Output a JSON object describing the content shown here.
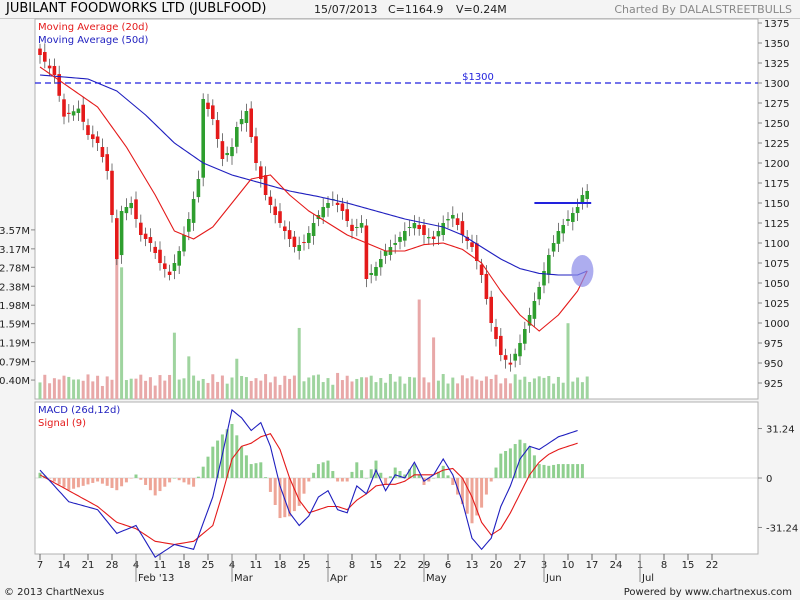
{
  "header": {
    "title": "JUBILANT FOODWORKS LTD (JUBLFOOD)",
    "date": "15/07/2013",
    "close": "C=1164.9",
    "volume": "V=0.24M",
    "credit": "Charted By DALALSTREETBULLS"
  },
  "footer": {
    "copyright": "© 2013 ChartNexus",
    "powered": "Powered by www.chartnexus.com"
  },
  "colors": {
    "up": "#2e9e2e",
    "down": "#e41a1a",
    "ma20": "#e41a1a",
    "ma50": "#1f1fbf",
    "vol_up": "#9fd49f",
    "vol_down": "#e8a8a8",
    "macd": "#1f1fbf",
    "signal": "#e41a1a",
    "hist_up": "#8fcf8f",
    "hist_down": "#eea597",
    "resistance": "#2222dd",
    "highlight": "#8a8ae8"
  },
  "chart_data": [
    {
      "type": "candlestick",
      "title": "",
      "legend": [
        "Moving Average (20d)",
        "Moving Average (50d)"
      ],
      "legend_placement": "top-left",
      "price_ticks": [
        925,
        950,
        975,
        1000,
        1025,
        1050,
        1075,
        1100,
        1125,
        1150,
        1175,
        1200,
        1225,
        1250,
        1275,
        1300,
        1325,
        1350,
        1375
      ],
      "ylim": [
        905,
        1380
      ],
      "volume_ticks": [
        "0.40M",
        "0.79M",
        "1.19M",
        "1.59M",
        "1.98M",
        "2.38M",
        "2.78M",
        "3.17M",
        "3.57M"
      ],
      "volume_tick_values": [
        0.4,
        0.79,
        1.19,
        1.59,
        1.98,
        2.38,
        2.78,
        3.17,
        3.57
      ],
      "volume_max": 3.8,
      "annotation": "$1300",
      "annotation_level": 1300,
      "resistance_level": 1150,
      "x_ticks": [
        "7",
        "14",
        "21",
        "28",
        "4",
        "11",
        "18",
        "25",
        "4",
        "11",
        "18",
        "25",
        "1",
        "8",
        "15",
        "22",
        "29",
        "6",
        "13",
        "20",
        "27",
        "3",
        "10",
        "17",
        "24",
        "1",
        "8",
        "15",
        "22"
      ],
      "x_tick_days": [
        0,
        5,
        10,
        15,
        20,
        25,
        30,
        35,
        40,
        45,
        50,
        55,
        60,
        65,
        70,
        75,
        80,
        85,
        90,
        95,
        100,
        105,
        110,
        115,
        120,
        125,
        130,
        135,
        140
      ],
      "month_labels": [
        {
          "label": "Feb '13",
          "day": 20
        },
        {
          "label": "Mar",
          "day": 40
        },
        {
          "label": "Apr",
          "day": 60
        },
        {
          "label": "May",
          "day": 80
        },
        {
          "label": "Jun",
          "day": 105
        },
        {
          "label": "Jul",
          "day": 125
        }
      ],
      "price_keypoints": [
        [
          0,
          1335
        ],
        [
          3,
          1310
        ],
        [
          5,
          1258
        ],
        [
          8,
          1268
        ],
        [
          10,
          1235
        ],
        [
          12,
          1225
        ],
        [
          14,
          1190
        ],
        [
          16,
          1080
        ],
        [
          17,
          1140
        ],
        [
          19,
          1150
        ],
        [
          21,
          1110
        ],
        [
          23,
          1100
        ],
        [
          25,
          1075
        ],
        [
          27,
          1060
        ],
        [
          29,
          1090
        ],
        [
          31,
          1130
        ],
        [
          33,
          1180
        ],
        [
          34,
          1280
        ],
        [
          36,
          1255
        ],
        [
          37,
          1230
        ],
        [
          38,
          1205
        ],
        [
          40,
          1220
        ],
        [
          41,
          1245
        ],
        [
          43,
          1265
        ],
        [
          45,
          1200
        ],
        [
          47,
          1160
        ],
        [
          49,
          1135
        ],
        [
          51,
          1115
        ],
        [
          53,
          1095
        ],
        [
          55,
          1100
        ],
        [
          57,
          1125
        ],
        [
          59,
          1145
        ],
        [
          61,
          1155
        ],
        [
          63,
          1140
        ],
        [
          65,
          1115
        ],
        [
          67,
          1125
        ],
        [
          68,
          1055
        ],
        [
          70,
          1070
        ],
        [
          72,
          1090
        ],
        [
          74,
          1100
        ],
        [
          76,
          1115
        ],
        [
          78,
          1125
        ],
        [
          80,
          1110
        ],
        [
          82,
          1105
        ],
        [
          84,
          1125
        ],
        [
          86,
          1135
        ],
        [
          88,
          1110
        ],
        [
          90,
          1095
        ],
        [
          92,
          1060
        ],
        [
          94,
          1000
        ],
        [
          96,
          960
        ],
        [
          98,
          948
        ],
        [
          100,
          975
        ],
        [
          102,
          1010
        ],
        [
          104,
          1045
        ],
        [
          106,
          1085
        ],
        [
          108,
          1115
        ],
        [
          110,
          1130
        ],
        [
          112,
          1145
        ],
        [
          113,
          1160
        ],
        [
          114,
          1165
        ]
      ],
      "volume_spikes": [
        [
          16,
          3.57
        ],
        [
          17,
          2.78
        ],
        [
          28,
          1.4
        ],
        [
          31,
          0.9
        ],
        [
          41,
          0.85
        ],
        [
          54,
          1.5
        ],
        [
          57,
          0.5
        ],
        [
          62,
          0.55
        ],
        [
          79,
          2.1
        ],
        [
          82,
          1.3
        ],
        [
          110,
          1.6
        ]
      ],
      "ma20_keypoints": [
        [
          0,
          1320
        ],
        [
          6,
          1295
        ],
        [
          12,
          1270
        ],
        [
          18,
          1220
        ],
        [
          24,
          1160
        ],
        [
          28,
          1115
        ],
        [
          32,
          1105
        ],
        [
          36,
          1120
        ],
        [
          40,
          1150
        ],
        [
          44,
          1180
        ],
        [
          48,
          1185
        ],
        [
          52,
          1160
        ],
        [
          56,
          1140
        ],
        [
          60,
          1125
        ],
        [
          64,
          1110
        ],
        [
          68,
          1100
        ],
        [
          72,
          1090
        ],
        [
          76,
          1090
        ],
        [
          80,
          1098
        ],
        [
          84,
          1100
        ],
        [
          88,
          1092
        ],
        [
          92,
          1075
        ],
        [
          96,
          1040
        ],
        [
          100,
          1010
        ],
        [
          104,
          990
        ],
        [
          108,
          1010
        ],
        [
          112,
          1040
        ],
        [
          114,
          1065
        ]
      ],
      "ma50_keypoints": [
        [
          0,
          1310
        ],
        [
          10,
          1305
        ],
        [
          16,
          1290
        ],
        [
          22,
          1260
        ],
        [
          28,
          1225
        ],
        [
          34,
          1200
        ],
        [
          40,
          1185
        ],
        [
          46,
          1175
        ],
        [
          52,
          1165
        ],
        [
          58,
          1158
        ],
        [
          64,
          1150
        ],
        [
          70,
          1140
        ],
        [
          76,
          1130
        ],
        [
          80,
          1125
        ],
        [
          84,
          1120
        ],
        [
          88,
          1110
        ],
        [
          92,
          1095
        ],
        [
          96,
          1080
        ],
        [
          100,
          1068
        ],
        [
          104,
          1062
        ],
        [
          108,
          1060
        ],
        [
          112,
          1060
        ],
        [
          114,
          1065
        ]
      ]
    },
    {
      "type": "line",
      "title": "",
      "series": [
        {
          "name": "MACD (26d,12d)",
          "keypoints": [
            [
              0,
              5
            ],
            [
              6,
              -15
            ],
            [
              12,
              -20
            ],
            [
              16,
              -35
            ],
            [
              20,
              -30
            ],
            [
              24,
              -50
            ],
            [
              28,
              -42
            ],
            [
              32,
              -45
            ],
            [
              36,
              -12
            ],
            [
              38,
              15
            ],
            [
              40,
              43
            ],
            [
              42,
              38
            ],
            [
              44,
              30
            ],
            [
              46,
              35
            ],
            [
              48,
              20
            ],
            [
              50,
              -5
            ],
            [
              52,
              -22
            ],
            [
              54,
              -30
            ],
            [
              56,
              -24
            ],
            [
              58,
              -12
            ],
            [
              60,
              -8
            ],
            [
              62,
              -20
            ],
            [
              64,
              -22
            ],
            [
              66,
              -5
            ],
            [
              68,
              -10
            ],
            [
              70,
              5
            ],
            [
              72,
              -8
            ],
            [
              74,
              2
            ],
            [
              76,
              0
            ],
            [
              78,
              10
            ],
            [
              80,
              -2
            ],
            [
              82,
              2
            ],
            [
              84,
              12
            ],
            [
              86,
              2
            ],
            [
              88,
              -15
            ],
            [
              90,
              -38
            ],
            [
              92,
              -45
            ],
            [
              94,
              -38
            ],
            [
              96,
              -18
            ],
            [
              98,
              -5
            ],
            [
              100,
              12
            ],
            [
              102,
              20
            ],
            [
              104,
              18
            ],
            [
              106,
              22
            ],
            [
              108,
              26
            ],
            [
              110,
              28
            ],
            [
              112,
              30
            ]
          ]
        },
        {
          "name": "Signal (9)",
          "keypoints": [
            [
              0,
              2
            ],
            [
              6,
              -8
            ],
            [
              12,
              -18
            ],
            [
              16,
              -28
            ],
            [
              20,
              -32
            ],
            [
              24,
              -40
            ],
            [
              28,
              -42
            ],
            [
              32,
              -40
            ],
            [
              36,
              -30
            ],
            [
              38,
              -10
            ],
            [
              40,
              12
            ],
            [
              42,
              20
            ],
            [
              44,
              22
            ],
            [
              46,
              26
            ],
            [
              48,
              28
            ],
            [
              50,
              18
            ],
            [
              52,
              0
            ],
            [
              54,
              -14
            ],
            [
              56,
              -22
            ],
            [
              58,
              -20
            ],
            [
              60,
              -18
            ],
            [
              62,
              -18
            ],
            [
              64,
              -20
            ],
            [
              66,
              -14
            ],
            [
              68,
              -10
            ],
            [
              70,
              -5
            ],
            [
              72,
              -4
            ],
            [
              74,
              -4
            ],
            [
              76,
              -2
            ],
            [
              78,
              2
            ],
            [
              80,
              2
            ],
            [
              82,
              2
            ],
            [
              84,
              5
            ],
            [
              86,
              6
            ],
            [
              88,
              0
            ],
            [
              90,
              -12
            ],
            [
              92,
              -28
            ],
            [
              94,
              -36
            ],
            [
              96,
              -32
            ],
            [
              98,
              -22
            ],
            [
              100,
              -10
            ],
            [
              102,
              2
            ],
            [
              104,
              10
            ],
            [
              106,
              15
            ],
            [
              108,
              18
            ],
            [
              110,
              20
            ],
            [
              112,
              22
            ]
          ]
        }
      ],
      "y_ticks": [
        "31.24",
        "0",
        "-31.24"
      ],
      "y_tick_values": [
        31.24,
        0,
        -31.24
      ],
      "ylim": [
        -48,
        48
      ]
    }
  ]
}
